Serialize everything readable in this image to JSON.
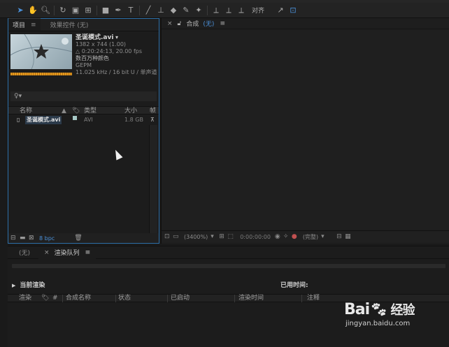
{
  "toolbar": {
    "align_label": "对齐"
  },
  "project_panel": {
    "tabs": [
      {
        "label": "项目",
        "active": true
      },
      {
        "label": "效果控件 (无)",
        "active": false
      }
    ],
    "footage": {
      "filename": "圣诞模式.avi",
      "resolution": "1382 x 744 (1.00)",
      "duration": "△ 0:20:24:13, 20.00 fps",
      "colors": "数百万种颜色",
      "codec": "GEPM",
      "audio": "11.025 kHz / 16 bit U / 单声道"
    },
    "search_icon_label": "♀▾",
    "columns": {
      "name": "名称",
      "type": "类型",
      "size": "大小",
      "frame": "帧"
    },
    "rows": [
      {
        "name": "圣诞模式.avi",
        "type": "AVI",
        "size": "1.8 GB"
      }
    ],
    "bpc": "8 bpc"
  },
  "comp_panel": {
    "tab_label": "合成",
    "tab_state": "(无)",
    "zoom": "(3400%)",
    "timecode": "0:00:00:00",
    "resolution": "(完整)"
  },
  "render_queue": {
    "tabs": [
      {
        "label": "(无)",
        "active": false
      },
      {
        "label": "渲染队列",
        "active": true
      }
    ],
    "current_render": "当前渲染",
    "elapsed": "已用时间:",
    "columns": [
      "渲染",
      "#",
      "合成名称",
      "状态",
      "已启动",
      "渲染时间",
      "注释"
    ]
  },
  "watermark": {
    "brand": "Bai",
    "brand_suffix": "经验",
    "url": "jingyan.baidu.com"
  },
  "colors": {
    "accent_blue": "#4a90d9",
    "panel_border": "#2d6fa8",
    "waveform": "#e09a20"
  }
}
